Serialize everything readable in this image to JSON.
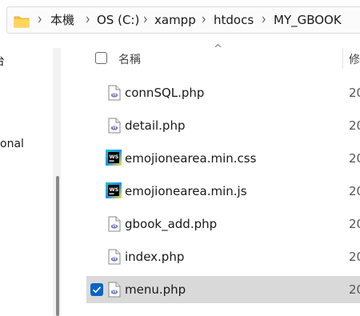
{
  "address": {
    "crumbs": [
      "本機",
      "OS (C:)",
      "xampp",
      "htdocs",
      "MY_GBOOK"
    ]
  },
  "nav": {
    "fragment1": "台",
    "fragment2": "onal"
  },
  "list": {
    "header_name": "名稱",
    "header_date": "修",
    "files": [
      {
        "name": "connSQL.php",
        "date": "20",
        "icon": "php-file-icon",
        "selected": false
      },
      {
        "name": "detail.php",
        "date": "20",
        "icon": "php-file-icon",
        "selected": false
      },
      {
        "name": "emojionearea.min.css",
        "date": "20",
        "icon": "webstorm-file-icon",
        "selected": false
      },
      {
        "name": "emojionearea.min.js",
        "date": "20",
        "icon": "webstorm-file-icon",
        "selected": false
      },
      {
        "name": "gbook_add.php",
        "date": "20",
        "icon": "php-file-icon",
        "selected": false
      },
      {
        "name": "index.php",
        "date": "20",
        "icon": "php-file-icon",
        "selected": false
      },
      {
        "name": "menu.php",
        "date": "20",
        "icon": "php-file-icon",
        "selected": true
      }
    ]
  },
  "colors": {
    "selection": "#d9d9d9",
    "checkbox_accent": "#0b63c4",
    "folder": "#f4c542"
  }
}
